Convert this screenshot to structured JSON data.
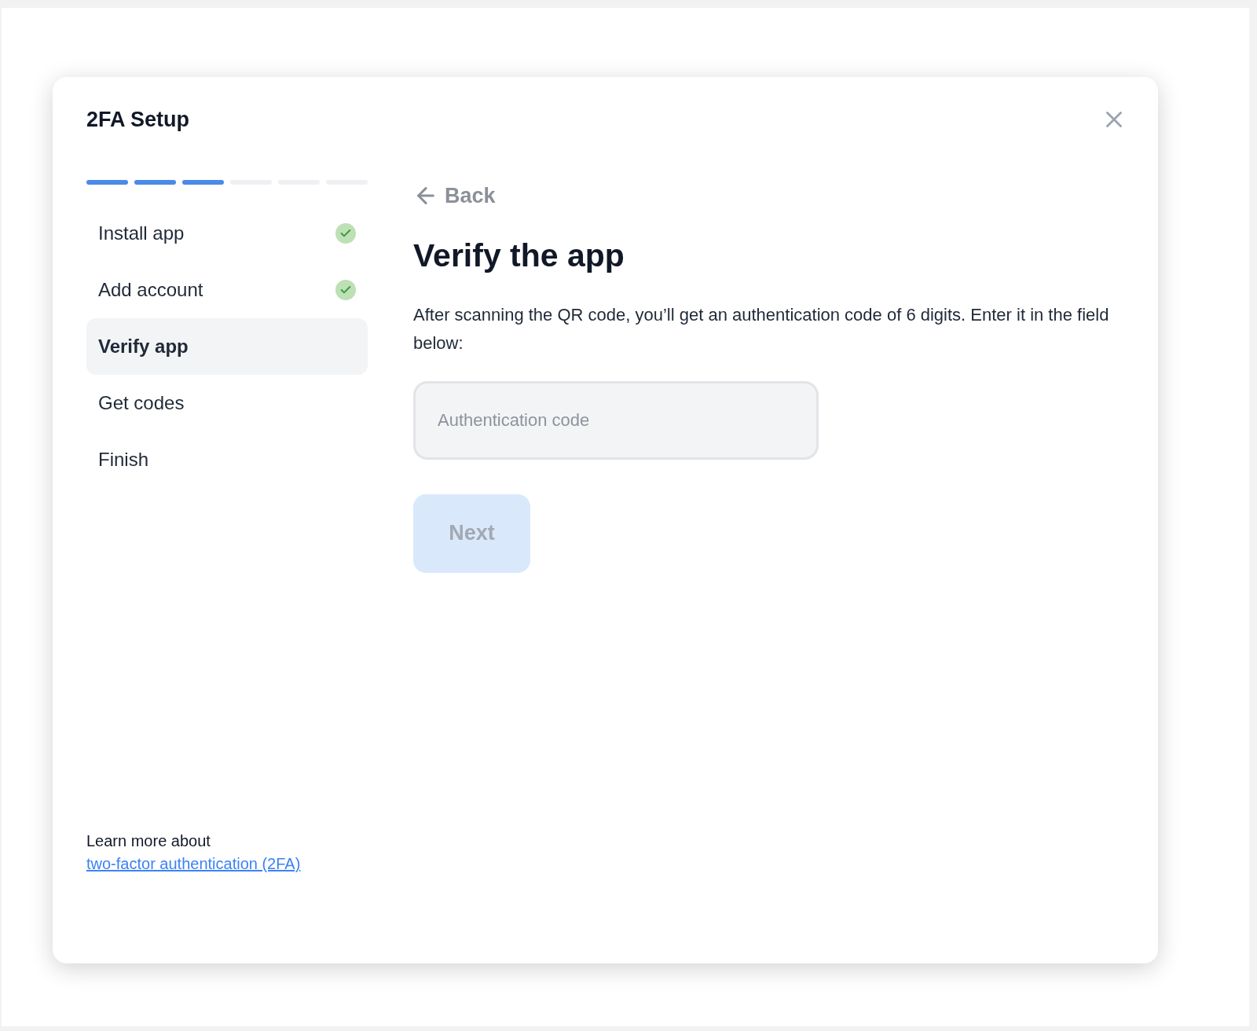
{
  "dialog": {
    "title": "2FA Setup"
  },
  "progress": [
    {
      "filled": true
    },
    {
      "filled": true
    },
    {
      "filled": true
    },
    {
      "filled": false
    },
    {
      "filled": false
    },
    {
      "filled": false
    }
  ],
  "steps": [
    {
      "label": "Install app",
      "completed": true,
      "selected": false
    },
    {
      "label": "Add account",
      "completed": true,
      "selected": false
    },
    {
      "label": "Verify app",
      "completed": false,
      "selected": true
    },
    {
      "label": "Get codes",
      "completed": false,
      "selected": false
    },
    {
      "label": "Finish",
      "completed": false,
      "selected": false
    }
  ],
  "footer": {
    "text": "Learn more about",
    "link": "two-factor authentication (2FA)"
  },
  "back": "Back",
  "heading": "Verify the app",
  "description": "After scanning the QR code, you’ll get an authentication code of 6 digits. Enter it in the field below:",
  "code_field": {
    "placeholder": "Authentication code"
  },
  "next_button": {
    "label": "Next",
    "disabled": true
  }
}
